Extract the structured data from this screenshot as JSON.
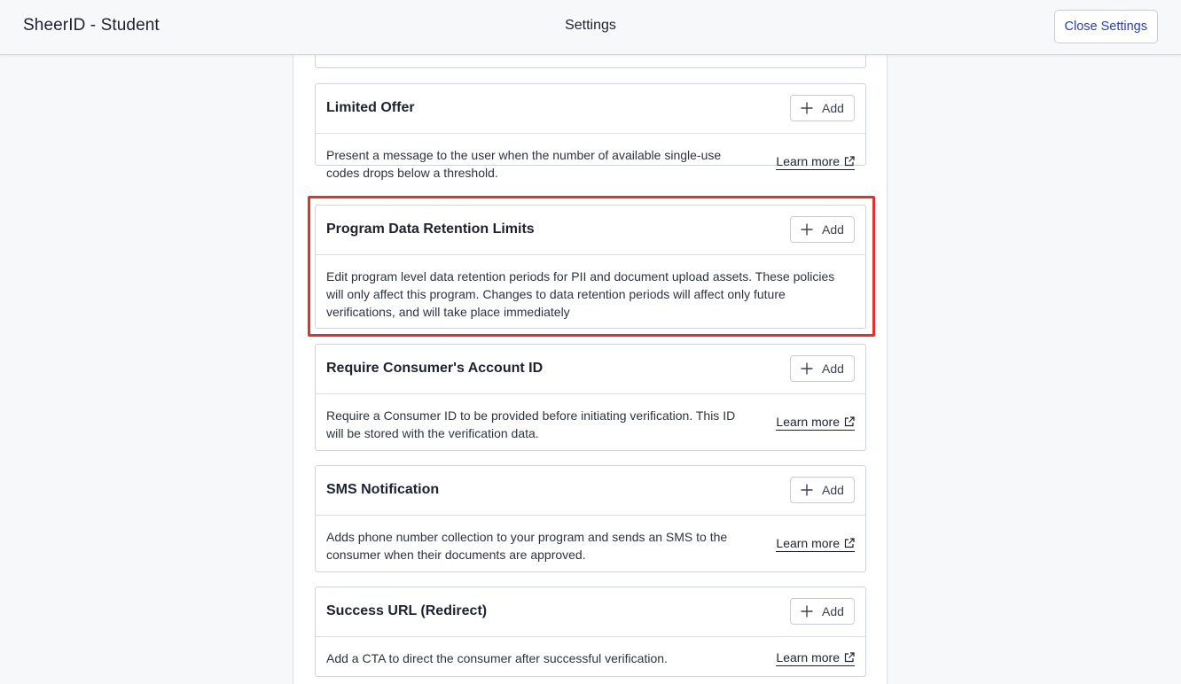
{
  "header": {
    "app_title": "SheerID - Student",
    "page_title": "Settings",
    "close_label": "Close Settings"
  },
  "cards": [
    {
      "title": "Limited Offer",
      "add_label": "Add",
      "description": "Present a message to the user when the number of available single-use codes drops below a threshold.",
      "learn_more": "Learn more"
    },
    {
      "title": "Program Data Retention Limits",
      "add_label": "Add",
      "description": "Edit program level data retention periods for PII and document upload assets. These policies will only affect this program. Changes to data retention periods will affect only future verifications, and will take place immediately"
    },
    {
      "title": "Require Consumer's Account ID",
      "add_label": "Add",
      "description": "Require a Consumer ID to be provided before initiating verification. This ID will be stored with the verification data.",
      "learn_more": "Learn more"
    },
    {
      "title": "SMS Notification",
      "add_label": "Add",
      "description": "Adds phone number collection to your program and sends an SMS to the consumer when their documents are approved.",
      "learn_more": "Learn more"
    },
    {
      "title": "Success URL (Redirect)",
      "add_label": "Add",
      "description": "Add a CTA to direct the consumer after successful verification.",
      "learn_more": "Learn more"
    }
  ],
  "colors": {
    "accent": "#2a3fb0",
    "highlight": "#e8302a"
  },
  "icons": {
    "add": "plus-icon",
    "learn_more": "external-link-icon"
  }
}
